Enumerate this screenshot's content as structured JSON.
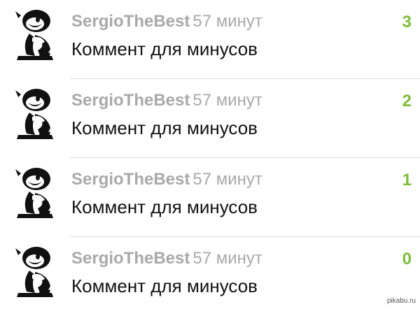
{
  "colors": {
    "username": "#a9a9a9",
    "time": "#a9a9a9",
    "comment_text": "#111111",
    "rating": "#7dbe3c",
    "divider": "#dcdcdc"
  },
  "comments": [
    {
      "avatar_icon": "cartoon-avatar-icon",
      "username": "SergioTheBest",
      "time": "57 минут",
      "text": "Коммент для минусов",
      "rating": "3"
    },
    {
      "avatar_icon": "cartoon-avatar-icon",
      "username": "SergioTheBest",
      "time": "57 минут",
      "text": "Коммент для минусов",
      "rating": "2"
    },
    {
      "avatar_icon": "cartoon-avatar-icon",
      "username": "SergioTheBest",
      "time": "57 минут",
      "text": "Коммент для минусов",
      "rating": "1"
    },
    {
      "avatar_icon": "cartoon-avatar-icon",
      "username": "SergioTheBest",
      "time": "57 минут",
      "text": "Коммент для минусов",
      "rating": "0"
    }
  ],
  "watermark": "pikabu.ru"
}
